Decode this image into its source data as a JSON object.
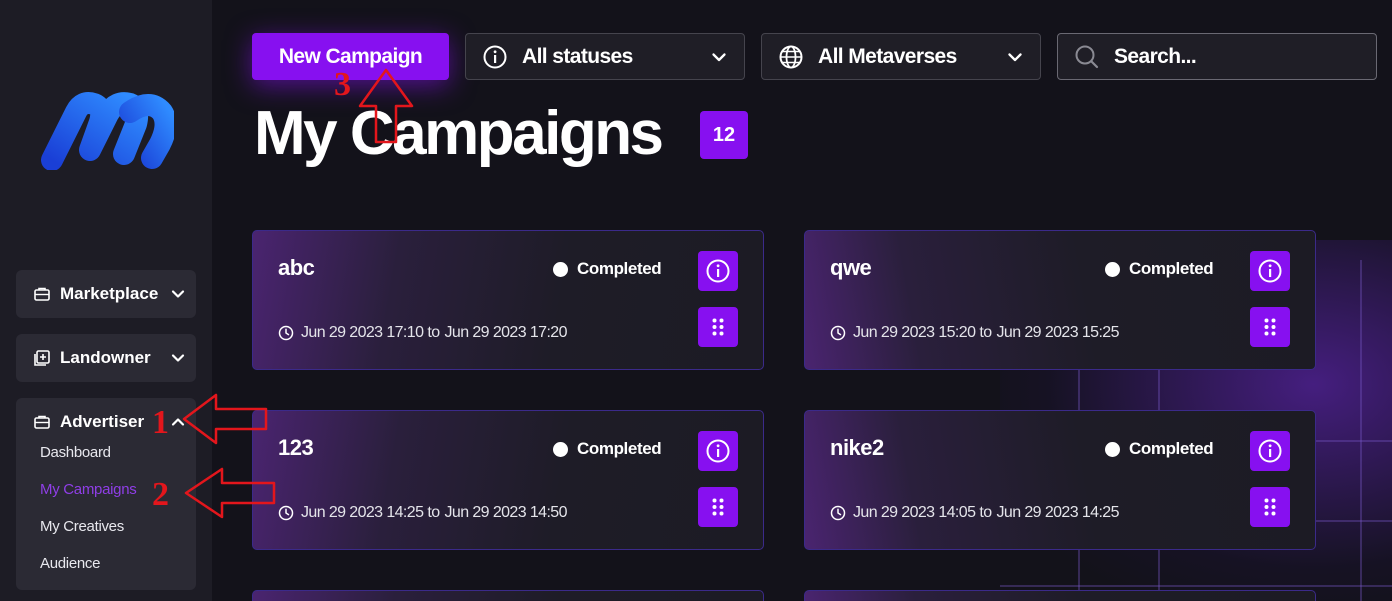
{
  "sidebar": {
    "groups": [
      {
        "label": "Marketplace",
        "expanded": false
      },
      {
        "label": "Landowner",
        "expanded": false
      },
      {
        "label": "Advertiser",
        "expanded": true,
        "items": [
          "Dashboard",
          "My Campaigns",
          "My Creatives",
          "Audience"
        ],
        "active_item": "My Campaigns"
      }
    ]
  },
  "toolbar": {
    "new_campaign_label": "New Campaign",
    "status_filter": "All statuses",
    "metaverse_filter": "All Metaverses",
    "search_placeholder": "Search..."
  },
  "page": {
    "title": "My Campaigns",
    "count": "12"
  },
  "campaigns": [
    {
      "name": "abc",
      "status": "Completed",
      "start": "Jun 29 2023 17:10",
      "to": "to",
      "end": "Jun 29 2023 17:20"
    },
    {
      "name": "qwe",
      "status": "Completed",
      "start": "Jun 29 2023 15:20",
      "to": "to",
      "end": "Jun 29 2023 15:25"
    },
    {
      "name": "123",
      "status": "Completed",
      "start": "Jun 29 2023 14:25",
      "to": "to",
      "end": "Jun 29 2023 14:50"
    },
    {
      "name": "nike2",
      "status": "Completed",
      "start": "Jun 29 2023 14:05",
      "to": "to",
      "end": "Jun 29 2023 14:25"
    }
  ],
  "annotations": [
    "1",
    "2",
    "3"
  ],
  "colors": {
    "accent": "#8710f0",
    "background": "#13121a",
    "sidebar": "#1d1c25",
    "active_nav": "#8f3ee6",
    "annotation": "#e3161c"
  },
  "icons": [
    "logo-icon",
    "briefcase-icon",
    "plus-square-icon",
    "chevron-down-icon",
    "chevron-up-icon",
    "info-icon",
    "globe-icon",
    "search-icon",
    "clock-icon",
    "dots-grid-icon",
    "arrow-icon"
  ]
}
